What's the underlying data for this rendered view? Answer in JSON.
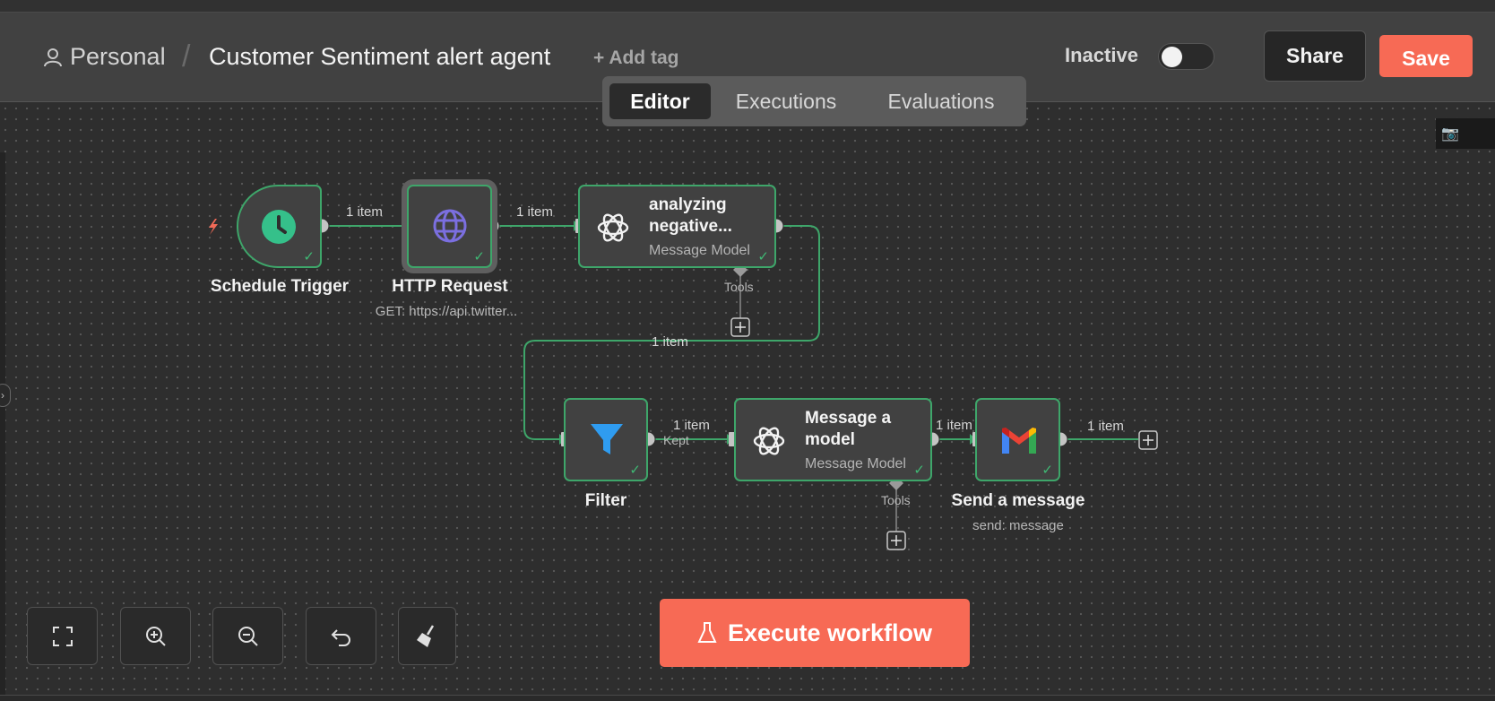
{
  "header": {
    "project": "Personal",
    "workflow_title": "Customer Sentiment alert agent",
    "add_tag": "+ Add tag",
    "status_label": "Inactive",
    "active": false,
    "share_label": "Share",
    "save_label": "Save"
  },
  "tabs": [
    {
      "label": "Editor",
      "active": true
    },
    {
      "label": "Executions",
      "active": false
    },
    {
      "label": "Evaluations",
      "active": false
    }
  ],
  "nodes": {
    "schedule": {
      "name": "Schedule Trigger"
    },
    "http": {
      "name": "HTTP Request",
      "desc": "GET: https://api.twitter..."
    },
    "analyze": {
      "title": "analyzing negative...",
      "subtitle": "Message Model",
      "tools_label": "Tools"
    },
    "filter": {
      "name": "Filter"
    },
    "message_model": {
      "title": "Message a model",
      "subtitle": "Message Model",
      "tools_label": "Tools"
    },
    "gmail": {
      "name": "Send a message",
      "desc": "send: message"
    }
  },
  "connections": {
    "trigger_to_http": "1 item",
    "http_to_analyze": "1 item",
    "analyze_to_filter": "1 item",
    "filter_to_model": "1 item",
    "filter_output": "Kept",
    "model_to_gmail": "1 item",
    "gmail_out": "1 item"
  },
  "execute_label": "Execute workflow",
  "colors": {
    "accent": "#f76a55",
    "node_border": "#3ea66a",
    "success": "#3fb874",
    "trigger_green": "#35c08a",
    "http_purple": "#7b6fe0",
    "filter_blue": "#2f9cf0"
  }
}
